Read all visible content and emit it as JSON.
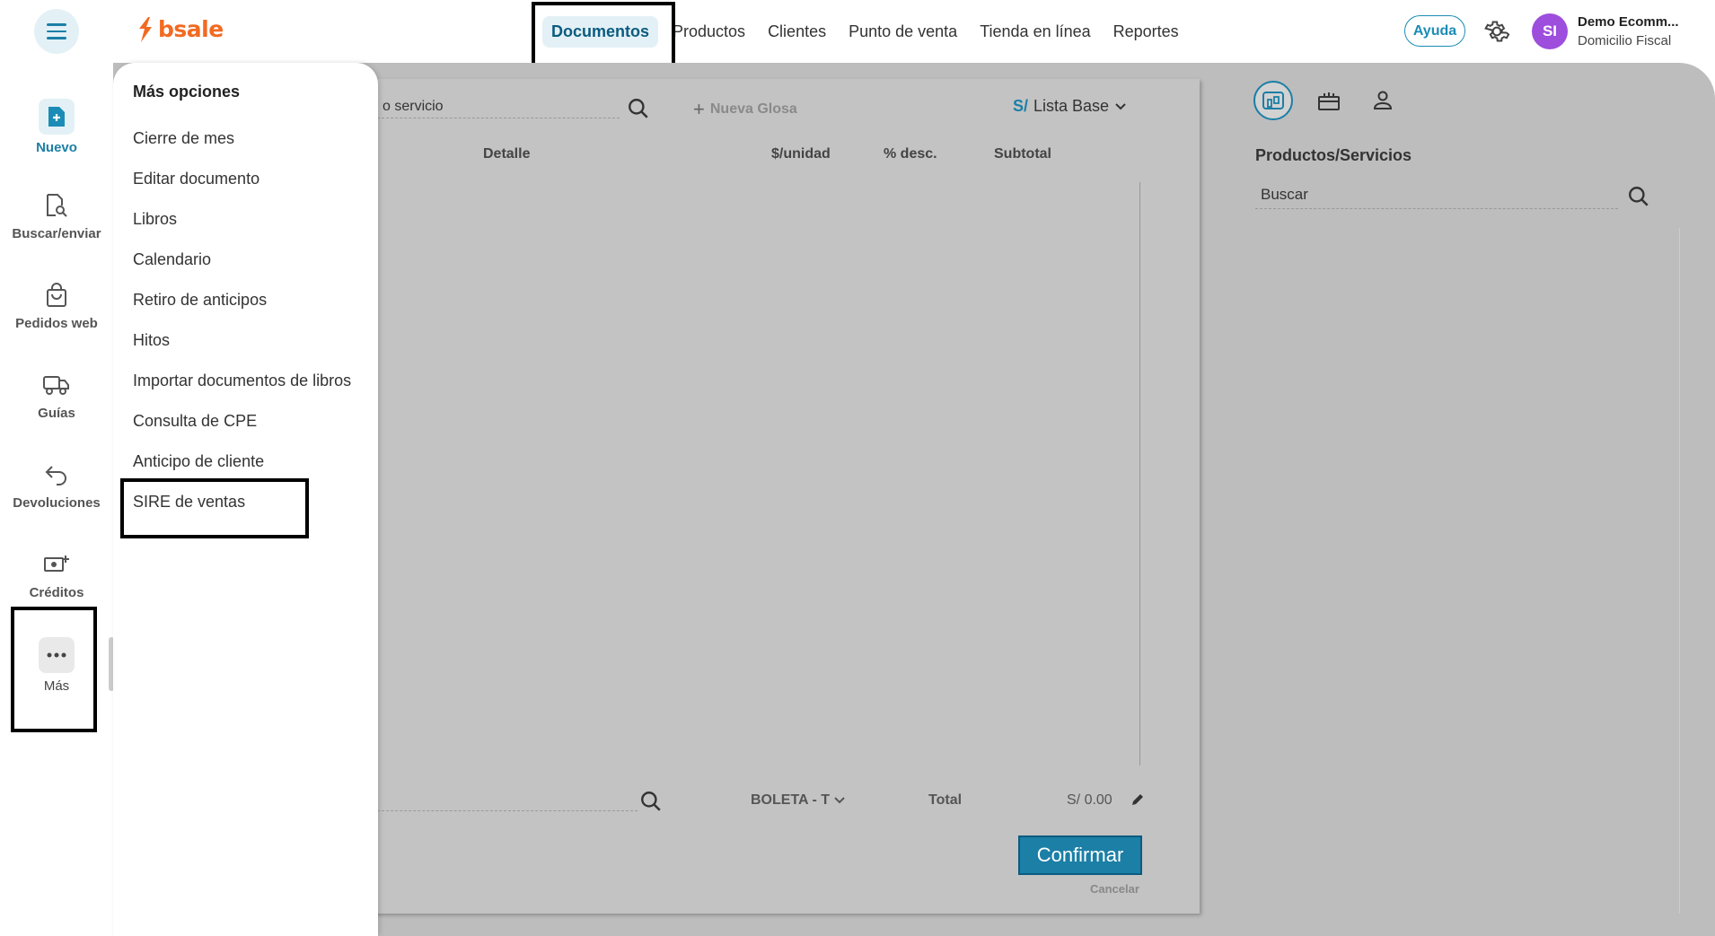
{
  "header": {
    "logo_text": "bsale",
    "nav": [
      "Documentos",
      "Productos",
      "Clientes",
      "Punto de venta",
      "Tienda en línea",
      "Reportes"
    ],
    "help_label": "Ayuda",
    "user": {
      "initials": "SI",
      "name": "Demo Ecomm...",
      "subtitle": "Domicilio Fiscal"
    }
  },
  "sidebar": {
    "items": [
      {
        "label": "Nuevo",
        "icon": "file-plus-icon"
      },
      {
        "label": "Buscar/enviar",
        "icon": "file-search-icon"
      },
      {
        "label": "Pedidos web",
        "icon": "shopping-bag-icon"
      },
      {
        "label": "Guías",
        "icon": "truck-icon"
      },
      {
        "label": "Devoluciones",
        "icon": "return-arrow-icon"
      },
      {
        "label": "Créditos",
        "icon": "money-plus-icon"
      },
      {
        "label": "Más",
        "icon": "more-dots-icon"
      }
    ]
  },
  "drawer": {
    "title": "Más opciones",
    "items": [
      "Cierre de mes",
      "Editar documento",
      "Libros",
      "Calendario",
      "Retiro de anticipos",
      "Hitos",
      "Importar documentos de libros",
      "Consulta de CPE",
      "Anticipo de cliente",
      "SIRE de ventas"
    ]
  },
  "document": {
    "search_value": "o servicio",
    "new_gloss": "Nueva Glosa",
    "currency_symbol": "S/",
    "price_list": "Lista Base",
    "columns": [
      "Detalle",
      "$/unidad",
      "% desc.",
      "Subtotal"
    ],
    "doc_type": "BOLETA - T",
    "total_label": "Total",
    "total_value": "S/ 0.00",
    "confirm_label": "Confirmar",
    "cancel_label": "Cancelar"
  },
  "products": {
    "title": "Productos/Servicios",
    "search_value": "Buscar"
  },
  "colors": {
    "accent": "#1b7fa6",
    "brand": "#f26a21",
    "overlay": "#bdbdbd",
    "avatar": "#9d4edd"
  }
}
